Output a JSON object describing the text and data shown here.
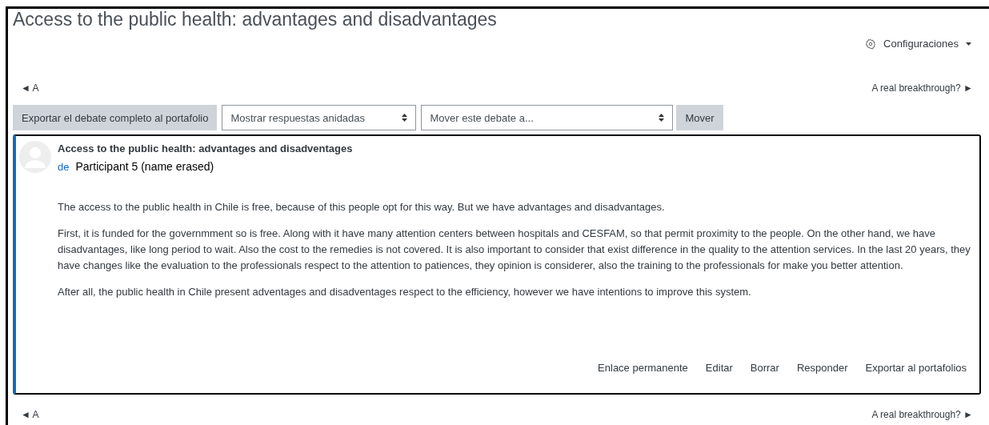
{
  "page_title": "Access to the public health: advantages and disadvantages",
  "settings_menu": {
    "label": "Configuraciones"
  },
  "nav_top": {
    "prev": "◄ A",
    "next": "A real breakthrough? ►"
  },
  "toolbar": {
    "export_button": "Exportar el debate completo al portafolio",
    "display_select": {
      "value": "Mostrar respuestas anidadas"
    },
    "move_select": {
      "value": "Mover este debate a..."
    },
    "move_button": "Mover"
  },
  "post": {
    "subject": "Access to the public health: advantages and disadventages",
    "by_label": "de",
    "author": "Participant 5 (name erased)",
    "paragraphs": [
      "The access to the public health in Chile is free, because of this people opt for this way. But we have advantages and disadvantages.",
      "First, it is funded for the governmment so is free. Along with it have many attention centers between hospitals and CESFAM, so that permit proximity to the people. On the other hand, we have disadvantages, like long period to wait.  Also the cost to the remedies is not covered. It is also important to consider that exist difference in the quality to the attention services. In the last 20 years, they have changes like the evaluation to the professionals respect to the attention to patiences, they opinion is considerer, also the training to the professionals for make you better attention.",
      "After all, the public health in Chile present adventages and disadventages respect to the efficiency, however we have intentions to improve this system."
    ],
    "actions": [
      "Enlace permanente",
      "Editar",
      "Borrar",
      "Responder",
      "Exportar al portafolios"
    ]
  },
  "nav_bottom": {
    "prev": "◄ A",
    "next": "A real breakthrough? ►"
  }
}
